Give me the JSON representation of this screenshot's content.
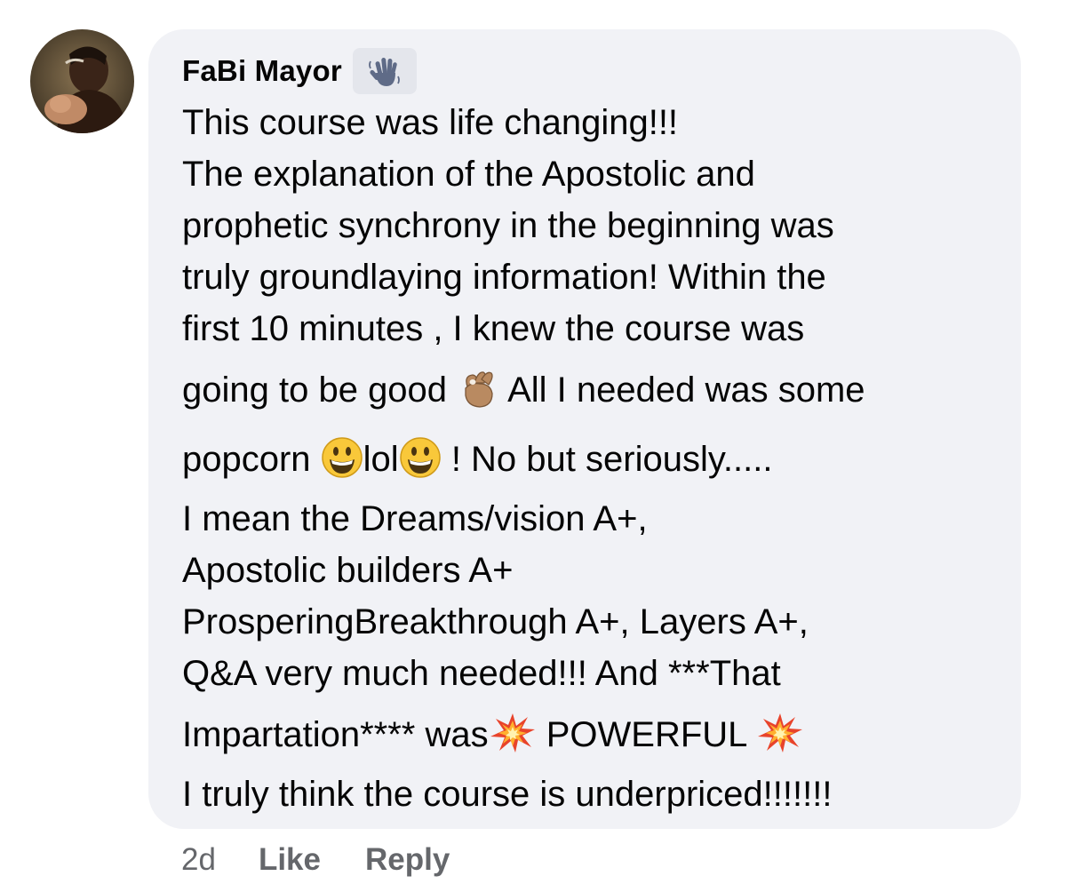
{
  "comment": {
    "author": "FaBi Mayor",
    "author_badge_icon": "waving-hand-icon",
    "lines": [
      "This course was life changing!!!",
      "The explanation of the Apostolic and",
      "prophetic synchrony in the beginning was",
      "truly groundlaying information! Within the",
      "first 10 minutes , I knew the course was"
    ],
    "line6": {
      "before": "going to be good ",
      "emoji": "ok-hand-emoji",
      "after": " All I needed was some"
    },
    "line7": {
      "start": "popcorn ",
      "emoji_a": "grinning-face-emoji",
      "mid": "lol",
      "emoji_b": "grinning-face-emoji",
      "end": " ! No but seriously....."
    },
    "lines_b": [
      "I mean the Dreams/vision A+,",
      "Apostolic builders A+",
      "ProsperingBreakthrough A+, Layers A+,",
      "Q&A very much needed!!! And ***That"
    ],
    "line12": {
      "before": "Impartation**** was",
      "emoji_a": "collision-emoji",
      "mid": " POWERFUL ",
      "emoji_b": "collision-emoji"
    },
    "last_line": "I truly think the course is underpriced!!!!!!!"
  },
  "actions": {
    "time": "2d",
    "like": "Like",
    "reply": "Reply"
  },
  "colors": {
    "bubble": "#f1f2f6",
    "text": "#050505",
    "secondary": "#65676b",
    "badge": "#e4e6ec"
  }
}
